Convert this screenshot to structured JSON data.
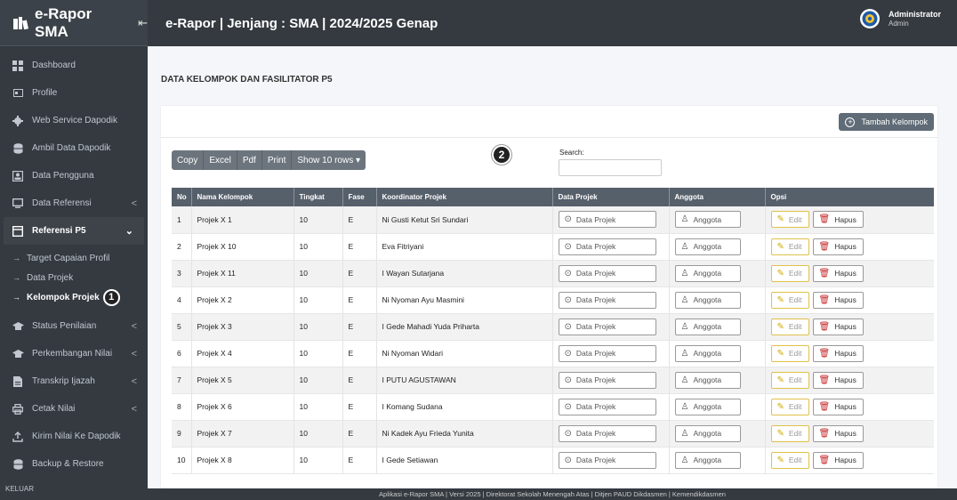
{
  "brand": {
    "title": "e-Rapor SMA",
    "collapse_icon": "⇤"
  },
  "topbar": {
    "title": "e-Rapor | Jenjang : SMA | 2024/2025 Genap"
  },
  "user": {
    "name": "Administrator",
    "role": "Admin"
  },
  "sidebar": {
    "items": [
      {
        "label": "Dashboard",
        "icon": "dashboard-icon"
      },
      {
        "label": "Profile",
        "icon": "profile-icon"
      },
      {
        "label": "Web Service Dapodik",
        "icon": "gear-icon"
      },
      {
        "label": "Ambil Data Dapodik",
        "icon": "database-icon"
      },
      {
        "label": "Data Pengguna",
        "icon": "user-card-icon"
      },
      {
        "label": "Data Referensi",
        "icon": "monitor-icon",
        "arrow": "<"
      },
      {
        "label": "Referensi P5",
        "icon": "window-icon",
        "arrow": "⌄"
      }
    ],
    "sub_items": [
      {
        "label": "Target Capaian Profil"
      },
      {
        "label": "Data Projek"
      },
      {
        "label": "Kelompok Projek"
      }
    ],
    "items_bottom": [
      {
        "label": "Status Penilaian",
        "icon": "graduation-cap-icon",
        "arrow": "<"
      },
      {
        "label": "Perkembangan Nilai",
        "icon": "graduation-cap-icon",
        "arrow": "<"
      },
      {
        "label": "Transkrip Ijazah",
        "icon": "file-icon",
        "arrow": "<"
      },
      {
        "label": "Cetak Nilai",
        "icon": "printer-icon",
        "arrow": "<"
      },
      {
        "label": "Kirim Nilai Ke Dapodik",
        "icon": "upload-icon"
      },
      {
        "label": "Backup & Restore",
        "icon": "database-icon"
      }
    ],
    "keluar": "KELUAR",
    "marker_1": "1"
  },
  "page": {
    "heading": "DATA KELOMPOK DAN FASILITATOR P5",
    "add_button": "Tambah Kelompok",
    "marker_2": "2",
    "search_label": "Search:",
    "search_value": ""
  },
  "dt_buttons": [
    "Copy",
    "Excel",
    "Pdf",
    "Print",
    "Show 10 rows ▾"
  ],
  "table": {
    "headers": [
      "No",
      "Nama Kelompok",
      "Tingkat",
      "Fase",
      "Koordinator Projek",
      "Data Projek",
      "Anggota",
      "Opsi"
    ],
    "action_labels": {
      "data_projek": "Data Projek",
      "anggota": "Anggota",
      "edit": "Edit",
      "hapus": "Hapus"
    },
    "rows": [
      {
        "no": "1",
        "nama": "Projek X 1",
        "tingkat": "10",
        "fase": "E",
        "koordinator": "Ni Gusti Ketut Sri Sundari"
      },
      {
        "no": "2",
        "nama": "Projek X 10",
        "tingkat": "10",
        "fase": "E",
        "koordinator": "Eva Fitriyani"
      },
      {
        "no": "3",
        "nama": "Projek X 11",
        "tingkat": "10",
        "fase": "E",
        "koordinator": "I Wayan Sutarjana"
      },
      {
        "no": "4",
        "nama": "Projek X 2",
        "tingkat": "10",
        "fase": "E",
        "koordinator": "Ni Nyoman Ayu Masmini"
      },
      {
        "no": "5",
        "nama": "Projek X 3",
        "tingkat": "10",
        "fase": "E",
        "koordinator": "I Gede Mahadi Yuda Priharta"
      },
      {
        "no": "6",
        "nama": "Projek X 4",
        "tingkat": "10",
        "fase": "E",
        "koordinator": "Ni Nyoman Widari"
      },
      {
        "no": "7",
        "nama": "Projek X 5",
        "tingkat": "10",
        "fase": "E",
        "koordinator": "I PUTU AGUSTAWAN"
      },
      {
        "no": "8",
        "nama": "Projek X 6",
        "tingkat": "10",
        "fase": "E",
        "koordinator": "I Komang Sudana"
      },
      {
        "no": "9",
        "nama": "Projek X 7",
        "tingkat": "10",
        "fase": "E",
        "koordinator": "Ni Kadek Ayu Frieda Yunita"
      },
      {
        "no": "10",
        "nama": "Projek X 8",
        "tingkat": "10",
        "fase": "E",
        "koordinator": "I Gede Setiawan"
      }
    ]
  },
  "footer": "Aplikasi e-Rapor SMA | Versi 2025 | Direktorat Sekolah Menengah Atas | Ditjen PAUD Dikdasmen | Kemendikdasmen"
}
